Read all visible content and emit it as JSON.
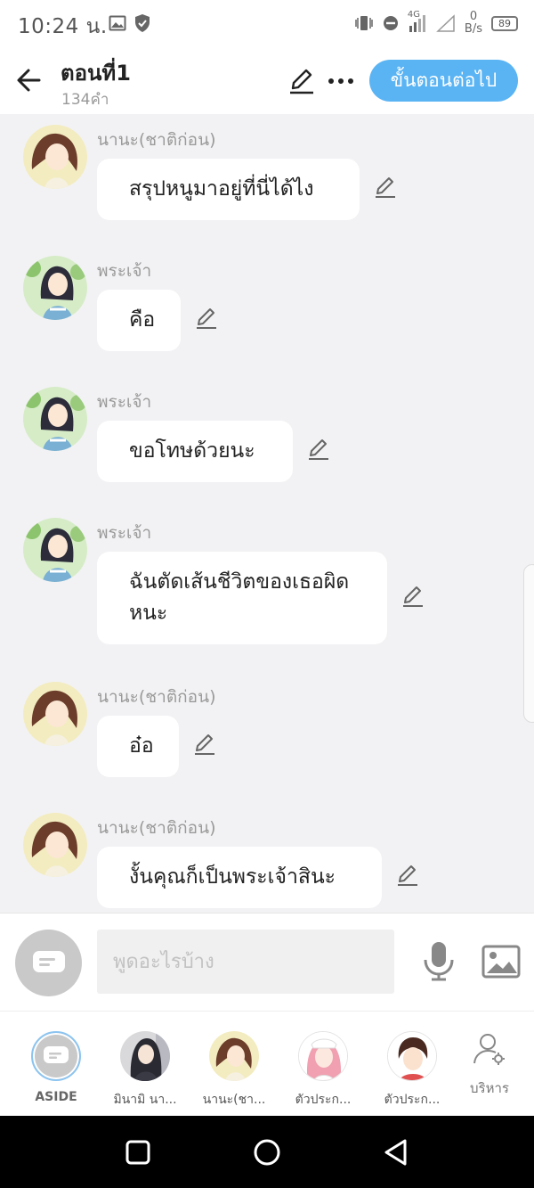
{
  "status_bar": {
    "time": "10:24 น.",
    "network_type": "4G",
    "net_speed_value": "0",
    "net_speed_unit": "B/s",
    "battery": "89",
    "icons": [
      "image-icon",
      "shield-icon",
      "vibrate-icon",
      "dnd-icon",
      "signal-icon",
      "wifi-icon",
      "battery-icon"
    ]
  },
  "header": {
    "title": "ตอนที่1",
    "subtitle": "134คำ",
    "next_button": "ขั้นตอนต่อไป"
  },
  "messages": [
    {
      "sender": "นานะ(ชาติก่อน)",
      "text": "สรุปหนูมาอยู่ที่นี่ได้ไง",
      "avatar": "nana"
    },
    {
      "sender": "พระเจ้า",
      "text": "คือ",
      "avatar": "god"
    },
    {
      "sender": "พระเจ้า",
      "text": "ขอโทษด้วยนะ",
      "avatar": "god"
    },
    {
      "sender": "พระเจ้า",
      "text": "ฉันตัดเส้นชีวิตของเธอผิดหนะ",
      "avatar": "god"
    },
    {
      "sender": "นานะ(ชาติก่อน)",
      "text": "อ๋อ",
      "avatar": "nana"
    },
    {
      "sender": "นานะ(ชาติก่อน)",
      "text": "งั้นคุณก็เป็นพระเจ้าสินะ",
      "avatar": "nana"
    }
  ],
  "input": {
    "placeholder": "พูดอะไรบ้าง",
    "value": ""
  },
  "characters": [
    {
      "label": "ASIDE"
    },
    {
      "label": "มินามิ นา..."
    },
    {
      "label": "นานะ(ชา..."
    },
    {
      "label": "ตัวประก..."
    },
    {
      "label": "ตัวประก..."
    }
  ],
  "manage_label": "บริหาร",
  "colors": {
    "accent": "#5ab4f4",
    "background": "#f2f2f4",
    "bubble": "#ffffff"
  }
}
